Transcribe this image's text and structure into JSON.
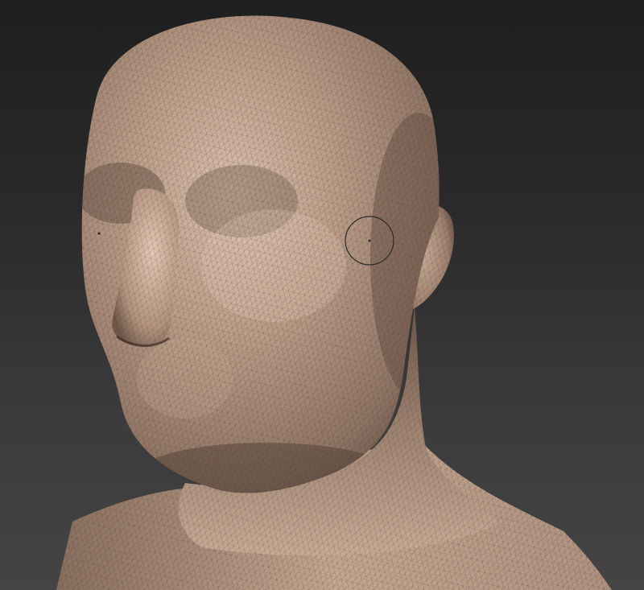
{
  "viewport": {
    "background_top": "#1f1f1f",
    "background_bottom": "#444444"
  },
  "model": {
    "skin_light": "#c9ab95",
    "skin_mid": "#a88b76",
    "skin_dark": "#5e4a3f",
    "wire_color": "#4a3a32"
  },
  "cursor": {
    "icon": "brush-circle-icon",
    "color": "#2a2a2a"
  }
}
